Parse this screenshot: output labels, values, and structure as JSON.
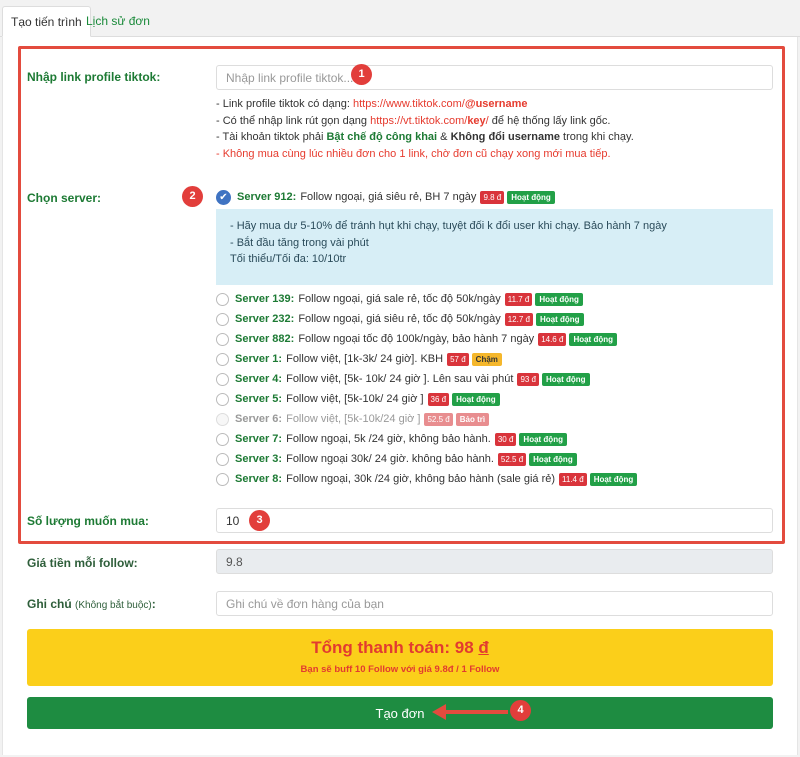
{
  "tabs": {
    "create": "Tạo tiến trình",
    "history": "Lịch sử đơn"
  },
  "form": {
    "profile_label": "Nhập link profile tiktok:",
    "profile_placeholder": "Nhập link profile tiktok...",
    "notes": {
      "line1_prefix": "- Link profile tiktok có dạng: ",
      "line1_link": "https://www.tiktok.com/",
      "line1_bold": "@username",
      "line2_prefix": "- Có thể nhập link rút gọn dạng ",
      "line2_link": "https://vt.tiktok.com/",
      "line2_bold": "key",
      "line2_slash": "/",
      "line2_suffix": " để hệ thống lấy link gốc.",
      "line3_prefix": "- Tài khoản tiktok phải ",
      "line3_green": "Bật chế độ công khai",
      "line3_amp": " & ",
      "line3_bold": "Không đổi username",
      "line3_suffix": " trong khi chạy.",
      "line4": "- Không mua cùng lúc nhiều đơn cho 1 link, chờ đơn cũ chạy xong mới mua tiếp."
    },
    "server_label": "Chọn server:",
    "selected_server": {
      "name": "Server 912:",
      "desc": "Follow ngoại, giá siêu rẻ, BH 7 ngày",
      "price": "9.8 đ",
      "status": "Hoạt động"
    },
    "info": {
      "line1": "- Hãy mua dư 5-10% để tránh hụt khi chạy, tuyệt đối k đổi user khi chạy. Bảo hành 7 ngày",
      "line2": "- Bắt đầu tăng trong vài phút",
      "line3": "Tối thiểu/Tối đa: 10/10tr"
    },
    "servers": [
      {
        "name": "Server 139:",
        "desc": "Follow ngoại, giá sale rẻ, tốc độ 50k/ngày",
        "price": "11.7 đ",
        "status": "Hoạt động"
      },
      {
        "name": "Server 232:",
        "desc": "Follow ngoại, giá siêu rẻ, tốc độ 50k/ngày",
        "price": "12.7 đ",
        "status": "Hoạt động"
      },
      {
        "name": "Server 882:",
        "desc": "Follow ngoại tốc độ 100k/ngày, bảo hành 7 ngày",
        "price": "14.6 đ",
        "status": "Hoạt động"
      },
      {
        "name": "Server 1:",
        "desc": "Follow việt, [1k-3k/ 24 giờ]. KBH",
        "price": "57 đ",
        "status": "Chậm"
      },
      {
        "name": "Server 4:",
        "desc": "Follow việt, [5k- 10k/ 24 giờ ]. Lên sau vài phút",
        "price": "93 đ",
        "status": "Hoạt động"
      },
      {
        "name": "Server 5:",
        "desc": "Follow việt, [5k-10k/ 24 giờ ]",
        "price": "36 đ",
        "status": "Hoạt động"
      },
      {
        "name": "Server 6:",
        "desc": "Follow việt, [5k-10k/24 giờ ]",
        "price": "52.5 đ",
        "status": "Bảo trì"
      },
      {
        "name": "Server 7:",
        "desc": "Follow ngoại, 5k /24 giờ, không bảo hành.",
        "price": "30 đ",
        "status": "Hoạt động"
      },
      {
        "name": "Server 3:",
        "desc": "Follow ngoại 30k/ 24 giờ. không bảo hành.",
        "price": "52.5 đ",
        "status": "Hoạt động"
      },
      {
        "name": "Server 8:",
        "desc": "Follow ngoại, 30k /24 giờ, không bảo hành (sale giá rẻ)",
        "price": "11.4 đ",
        "status": "Hoạt động"
      }
    ],
    "quantity_label": "Số lượng muốn mua:",
    "quantity_value": "10",
    "price_label": "Giá tiền mỗi follow:",
    "price_value": "9.8",
    "note_label": "Ghi chú",
    "note_optional": "(Không bắt buộc)",
    "note_colon": ":",
    "note_placeholder": "Ghi chú về đơn hàng của bạn"
  },
  "total": {
    "label": "Tổng thanh toán: 98 ",
    "currency": "đ",
    "detail": "Bạn sẽ buff 10 Follow với giá 9.8đ / 1 Follow"
  },
  "submit_label": "Tạo đơn",
  "markers": [
    "1",
    "2",
    "3",
    "4"
  ],
  "colors": {
    "brand_green": "#1e8c41",
    "danger": "#d9343b",
    "total_bg": "#fbcf1a",
    "annotation_red": "#e34b3e"
  }
}
